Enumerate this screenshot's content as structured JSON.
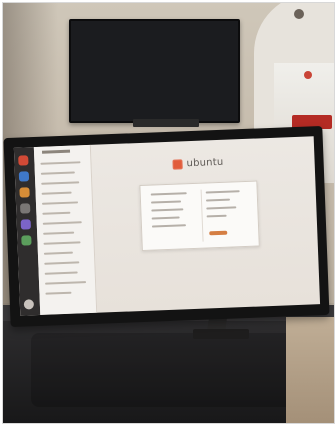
{
  "monitor": {
    "wordmark": "ubuntu"
  }
}
